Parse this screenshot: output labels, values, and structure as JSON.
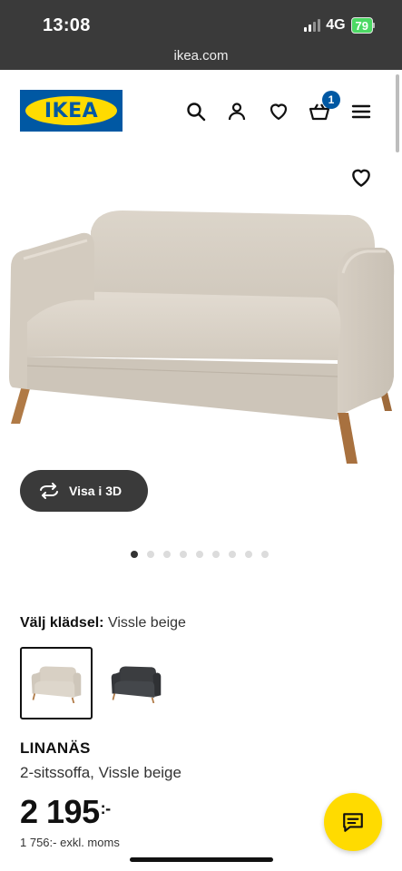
{
  "status_bar": {
    "time": "13:08",
    "network": "4G",
    "battery": "79"
  },
  "browser": {
    "url": "ikea.com"
  },
  "header": {
    "logo_text": "IKEA",
    "icons": [
      "search-icon",
      "user-icon",
      "heart-icon",
      "cart-icon",
      "menu-icon"
    ],
    "cart_count": "1"
  },
  "gallery": {
    "view_3d_label": "Visa i 3D",
    "image_count": 9,
    "active_index": 0
  },
  "variant": {
    "label": "Välj klädsel:",
    "value": "Vissle beige",
    "options": [
      {
        "name": "Vissle beige",
        "selected": true,
        "color": "#d8d0c4"
      },
      {
        "name": "dark grey",
        "selected": false,
        "color": "#3b3d40"
      }
    ]
  },
  "product": {
    "name": "LINANÄS",
    "description": "2-sitssoffa, Vissle beige",
    "price": "2 195",
    "price_suffix": ":-",
    "price_ex_vat": "1 756:- exkl. moms"
  },
  "colors": {
    "ikea_blue": "#0058a3",
    "ikea_yellow": "#ffdb00",
    "status_bar": "#3a3a3a"
  }
}
